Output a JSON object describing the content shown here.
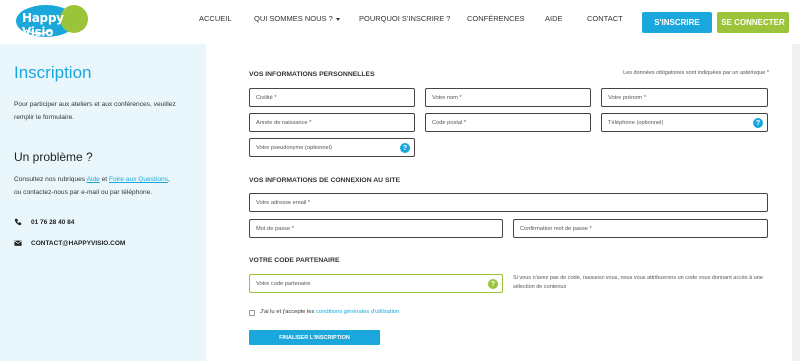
{
  "header": {
    "logo_text": "Happy Visio",
    "nav": [
      "ACCUEIL",
      "QUI SOMMES NOUS ?",
      "POURQUOI S'INSCRIRE ?",
      "CONFÉRENCES",
      "AIDE",
      "CONTACT"
    ],
    "signup_label": "S'INSCRIRE",
    "login_label": "SE CONNECTER"
  },
  "sidebar": {
    "title": "Inscription",
    "intro": "Pour participer aux ateliers et aux conférences, veuillez remplir le formulaire.",
    "problem_title": "Un problème ?",
    "problem_text_1": "Consultez nos rubriques ",
    "aide_link": "Aide",
    "and_text": " et ",
    "faq_link": "Foire aux Questions",
    "problem_text_2": ",",
    "problem_text_3": "ou contactez-nous par e-mail ou par téléphone.",
    "phone": "01 76 28 40 84",
    "email": "CONTACT@HAPPYVISIO.COM"
  },
  "form": {
    "personal_title": "VOS INFORMATIONS PERSONNELLES",
    "required_note": "Les données obligatoires sont indiquées par un astérisque *",
    "civilite": "Civilité *",
    "nom": "Votre nom *",
    "prenom": "Votre prénom *",
    "annee": "Année de naissance *",
    "code_postal": "Code postal *",
    "telephone": "Téléphone (optionnel)",
    "pseudo": "Votre pseudonyme (optionnel)",
    "connexion_title": "VOS INFORMATIONS DE CONNEXION AU SITE",
    "email": "Votre adresse email *",
    "password": "Mot de passe *",
    "password_confirm": "Confirmation mot de passe *",
    "partner_title": "VOTRE CODE PARTENAIRE",
    "partner_code": "Votre code partenaire",
    "partner_note": "Si vous n'avez pas de code, rassurez-vous, nous vous attribuerons un code vous donnant accès à une sélection de contenus",
    "terms_prefix": "J'ai lu et j'accepte les ",
    "terms_link": "conditions générales d'utilisation",
    "submit": "FINALISER L'INSCRIPTION"
  },
  "colors": {
    "accent": "#1aa8dc",
    "green": "#9cc43a",
    "sidebar_bg": "#e9f7fc"
  },
  "icons": [
    "phone-icon",
    "envelope-icon",
    "help-icon"
  ]
}
